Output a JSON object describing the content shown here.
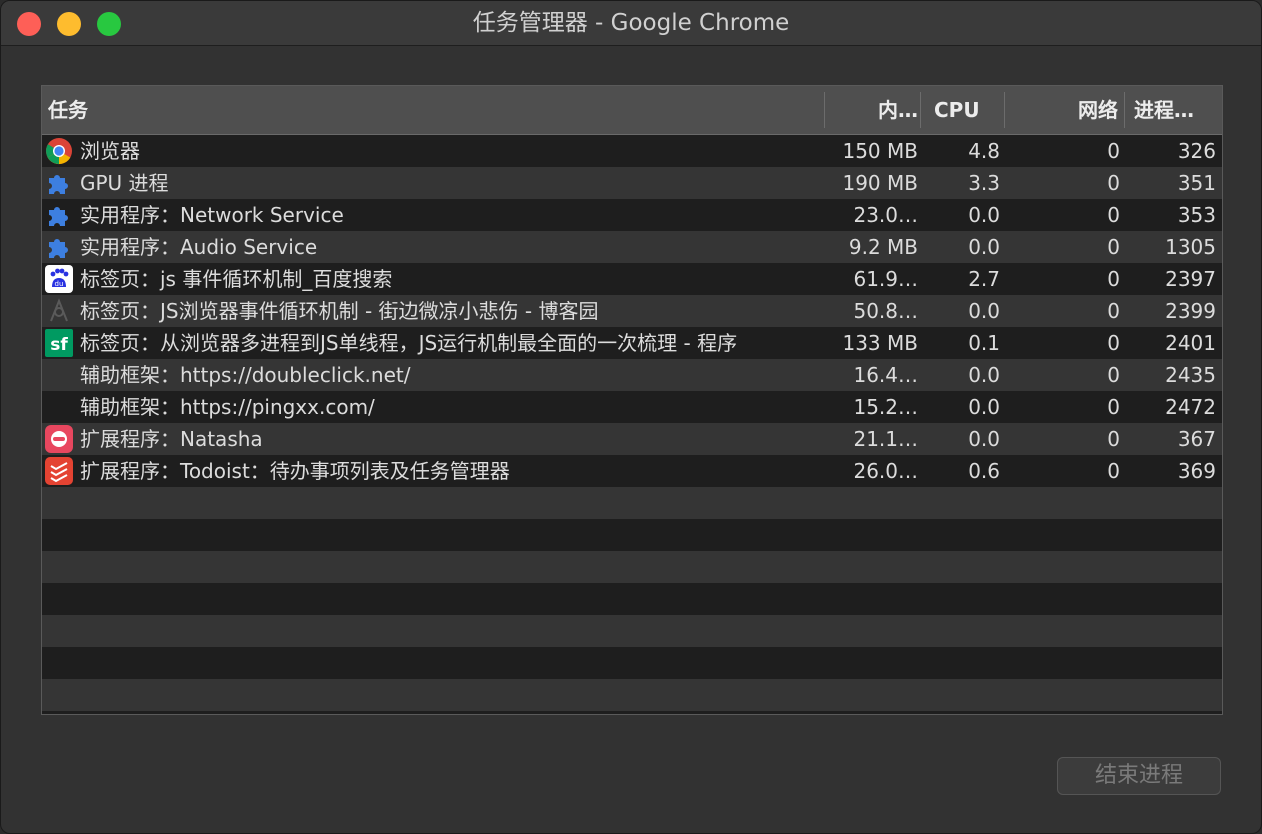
{
  "window": {
    "title": "任务管理器 - Google Chrome"
  },
  "table": {
    "headers": {
      "task": "任务",
      "memory": "内…",
      "cpu": "CPU",
      "network": "网络",
      "pid": "进程…"
    },
    "rows": [
      {
        "icon": "chrome-icon",
        "task": "浏览器",
        "memory": "150 MB",
        "cpu": "4.8",
        "network": "0",
        "pid": "326"
      },
      {
        "icon": "puzzle-icon",
        "task": "GPU 进程",
        "memory": "190 MB",
        "cpu": "3.3",
        "network": "0",
        "pid": "351"
      },
      {
        "icon": "puzzle-icon",
        "task": "实用程序：Network Service",
        "memory": "23.0…",
        "cpu": "0.0",
        "network": "0",
        "pid": "353"
      },
      {
        "icon": "puzzle-icon",
        "task": "实用程序：Audio Service",
        "memory": "9.2 MB",
        "cpu": "0.0",
        "network": "0",
        "pid": "1305"
      },
      {
        "icon": "baidu-icon",
        "task": "标签页：js 事件循环机制_百度搜索",
        "memory": "61.9…",
        "cpu": "2.7",
        "network": "0",
        "pid": "2397"
      },
      {
        "icon": "cnblogs-icon",
        "task": "标签页：JS浏览器事件循环机制 - 街边微凉小悲伤 - 博客园",
        "memory": "50.8…",
        "cpu": "0.0",
        "network": "0",
        "pid": "2399"
      },
      {
        "icon": "segmentfault-icon",
        "task": "标签页：从浏览器多进程到JS单线程，JS运行机制最全面的一次梳理 - 程序",
        "memory": "133 MB",
        "cpu": "0.1",
        "network": "0",
        "pid": "2401"
      },
      {
        "icon": "none",
        "task": "辅助框架：https://doubleclick.net/",
        "memory": "16.4…",
        "cpu": "0.0",
        "network": "0",
        "pid": "2435"
      },
      {
        "icon": "none",
        "task": "辅助框架：https://pingxx.com/",
        "memory": "15.2…",
        "cpu": "0.0",
        "network": "0",
        "pid": "2472"
      },
      {
        "icon": "natasha-icon",
        "task": "扩展程序：Natasha",
        "memory": "21.1…",
        "cpu": "0.0",
        "network": "0",
        "pid": "367"
      },
      {
        "icon": "todoist-icon",
        "task": "扩展程序：Todoist：待办事项列表及任务管理器",
        "memory": "26.0…",
        "cpu": "0.6",
        "network": "0",
        "pid": "369"
      }
    ],
    "empty_rows": 7
  },
  "footer": {
    "end_process_label": "结束进程"
  },
  "colors": {
    "close": "#fe5f57",
    "minimize": "#febc2e",
    "maximize": "#28c840",
    "puzzle": "#3d7fe0",
    "segmentfault": "#009a61",
    "natasha": "#e8475f",
    "todoist": "#e44332"
  }
}
